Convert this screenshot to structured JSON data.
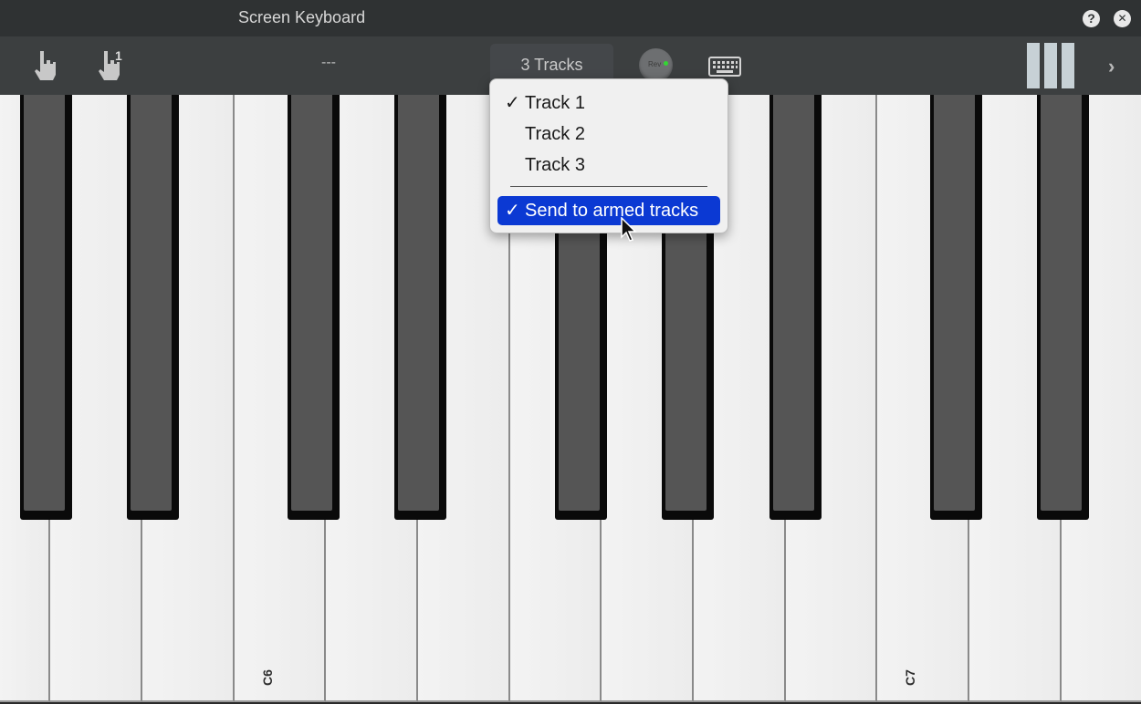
{
  "window": {
    "title": "Screen Keyboard"
  },
  "titlebar_icons": {
    "help": "?",
    "close": "✕"
  },
  "toolbar": {
    "hand_badge": "1",
    "preset": "---",
    "tracks_button": "3 Tracks",
    "reverb_label": "Rev",
    "forward_arrow": "›"
  },
  "menu": {
    "check": "✓",
    "items": [
      {
        "label": "Track 1",
        "checked": true
      },
      {
        "label": "Track 2",
        "checked": false
      },
      {
        "label": "Track 3",
        "checked": false
      }
    ],
    "send_armed": {
      "label": "Send to armed tracks",
      "checked": true
    }
  },
  "keyboard": {
    "labels": {
      "c6": "C6",
      "c7": "C7"
    }
  },
  "colors": {
    "titlebar": "#2f3233",
    "toolbar": "#3c3f40",
    "menu_highlight": "#0b39d3",
    "led": "#33d633"
  }
}
